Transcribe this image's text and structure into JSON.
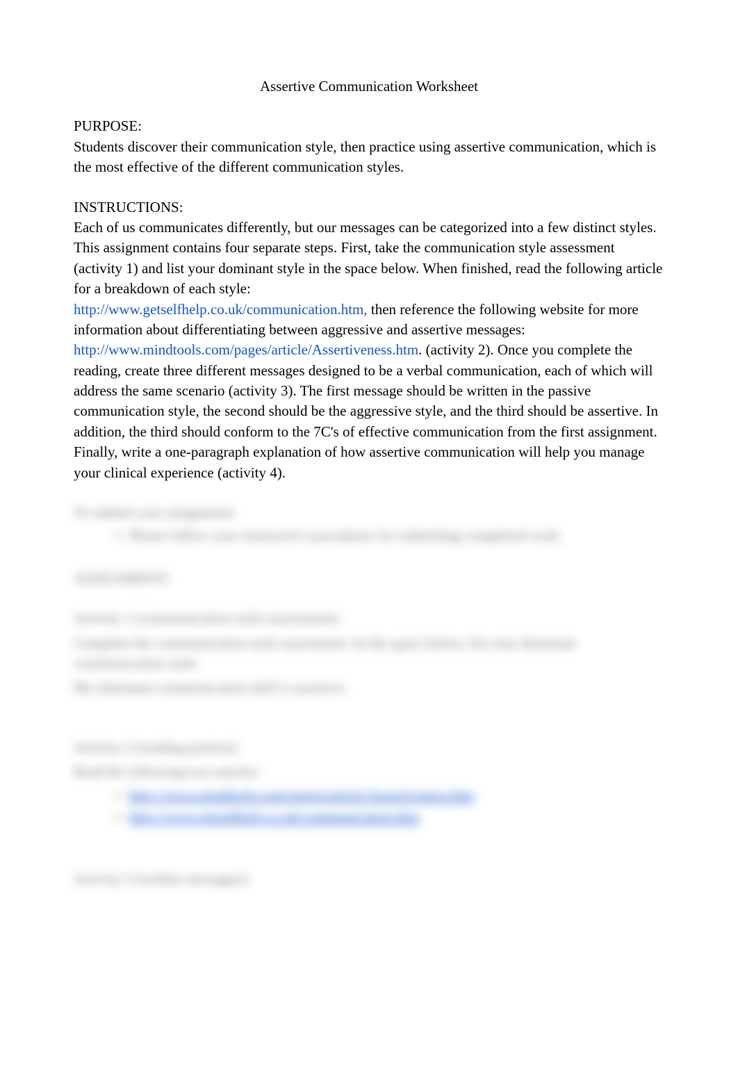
{
  "title": "Assertive Communication Worksheet",
  "purpose": {
    "heading": "PURPOSE:",
    "body": "Students discover their communication style, then practice using assertive communication, which is the most effective of the different communication styles."
  },
  "instructions": {
    "heading": "INSTRUCTIONS:",
    "body1": "Each of us communicates differently, but our messages can be categorized into a few distinct styles. This assignment contains four separate steps. First, take the communication style assessment (activity 1) and list your dominant style in the space below. When finished, read the following article for a breakdown of each style:",
    "link1": "http://www.getselfhelp.co.uk/communication.htm,",
    "body2": " then reference the following website for more information about differentiating between aggressive and assertive messages: ",
    "link2": "http://www.mindtools.com/pages/article/Assertiveness.htm",
    "body3": ". (activity 2). Once you complete the reading, create three different messages designed to be a verbal communication, each of which will address the same scenario (activity 3). The first message should be written in the passive communication style, the second should be the aggressive style, and the third should be assertive. In addition, the third should conform to the 7C's of effective communication from the first assignment. Finally, write a one-paragraph explanation of how assertive communication will help you manage your clinical experience (activity 4)."
  },
  "submit": {
    "heading": "To submit your assignment:",
    "item1": "Please follow your instructor's procedures for submitting completed work."
  },
  "assignment": {
    "heading": "ASSIGNMENT:"
  },
  "activity1": {
    "heading": "Activity 1 (communication style assessment):",
    "body": "Complete the communication style assessment. In the space below, list your dominant communication style.",
    "answer": "My dominant communication skill is assertive."
  },
  "activity2": {
    "heading": "Activity 2 (reading portion):",
    "body": "Read the following two articles:",
    "link1": "http://www.mindtools.com/pages/article/Assertiveness.htm",
    "link2": "http://www.getselfhelp.co.uk/communication.htm"
  },
  "activity3": {
    "heading": "Activity 3 (written messages):"
  }
}
